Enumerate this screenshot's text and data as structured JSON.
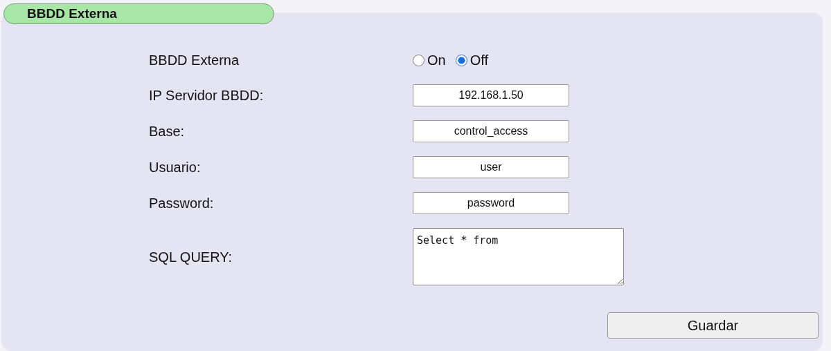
{
  "section": {
    "title": "BBDD Externa"
  },
  "form": {
    "rows": [
      {
        "kind": "radio",
        "label": "BBDD Externa",
        "options": [
          {
            "label": "On",
            "selected": false
          },
          {
            "label": "Off",
            "selected": true
          }
        ]
      },
      {
        "kind": "text",
        "label": "IP Servidor BBDD:",
        "value": "192.168.1.50"
      },
      {
        "kind": "text",
        "label": "Base:",
        "value": "control_access"
      },
      {
        "kind": "text",
        "label": "Usuario:",
        "value": "user"
      },
      {
        "kind": "text",
        "label": "Password:",
        "value": "password"
      },
      {
        "kind": "textarea",
        "label": "SQL QUERY:",
        "value": "Select * from"
      }
    ]
  },
  "buttons": [
    "Guardar"
  ]
}
